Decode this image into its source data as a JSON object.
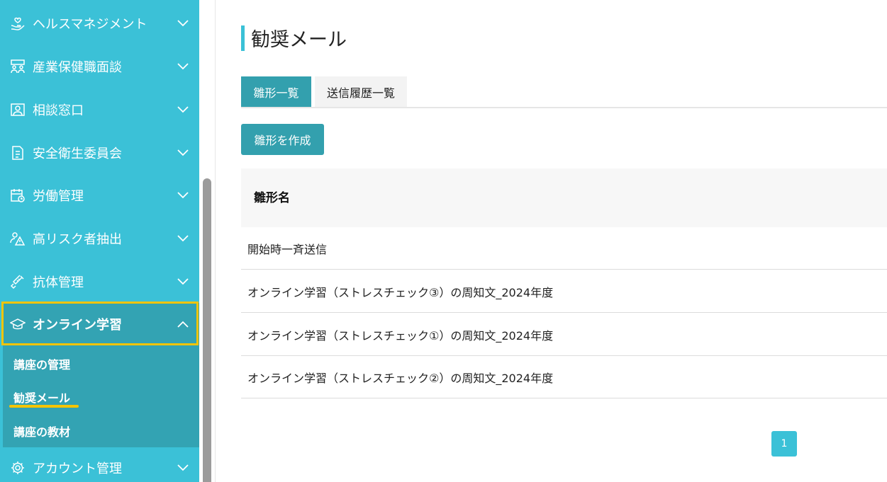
{
  "sidebar": {
    "items": [
      {
        "label": "ヘルスマネジメント",
        "icon": "hand-heart-icon",
        "expanded": false
      },
      {
        "label": "産業保健職面談",
        "icon": "interview-icon",
        "expanded": false
      },
      {
        "label": "相談窓口",
        "icon": "person-card-icon",
        "expanded": false
      },
      {
        "label": "安全衛生委員会",
        "icon": "document-icon",
        "expanded": false
      },
      {
        "label": "労働管理",
        "icon": "calendar-clock-icon",
        "expanded": false
      },
      {
        "label": "高リスク者抽出",
        "icon": "person-warning-icon",
        "expanded": false
      },
      {
        "label": "抗体管理",
        "icon": "syringe-icon",
        "expanded": false
      },
      {
        "label": "オンライン学習",
        "icon": "graduation-cap-icon",
        "expanded": true
      },
      {
        "label": "アカウント管理",
        "icon": "gear-icon",
        "expanded": false
      }
    ],
    "submenu": [
      {
        "label": "講座の管理"
      },
      {
        "label": "勧奨メール",
        "active": true
      },
      {
        "label": "講座の教材"
      }
    ]
  },
  "main": {
    "title": "勧奨メール",
    "tabs": [
      {
        "label": "雛形一覧",
        "active": true
      },
      {
        "label": "送信履歴一覧",
        "active": false
      }
    ],
    "create_button": "雛形を作成",
    "table": {
      "header": "雛形名",
      "rows": [
        "開始時一斉送信",
        "オンライン学習（ストレスチェック③）の周知文_2024年度",
        "オンライン学習（ストレスチェック①）の周知文_2024年度",
        "オンライン学習（ストレスチェック②）の周知文_2024年度"
      ]
    },
    "pagination": {
      "current": "1"
    }
  },
  "colors": {
    "sidebar_bg": "#3bc1d7",
    "sidebar_active": "#33a3b3",
    "highlight": "#f5c400",
    "button": "#33a0ae"
  }
}
